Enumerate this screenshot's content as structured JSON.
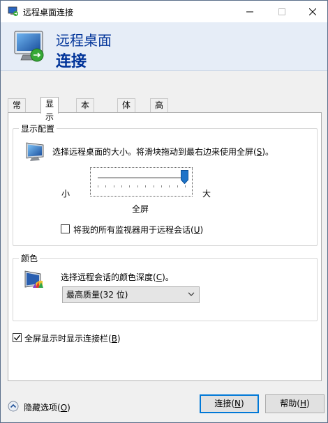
{
  "window": {
    "title": "远程桌面连接",
    "controls": {
      "minimize": "—",
      "maximize": "☐",
      "close": "✕"
    }
  },
  "banner": {
    "line1": "远程桌面",
    "line2": "连接"
  },
  "tabs": [
    {
      "label": "常规",
      "active": false
    },
    {
      "label": "显示",
      "active": true
    },
    {
      "label": "本地资源",
      "active": false
    },
    {
      "label": "体验",
      "active": false
    },
    {
      "label": "高级",
      "active": false
    }
  ],
  "display_config": {
    "group_title": "显示配置",
    "description": "选择远程桌面的大小。将滑块拖动到最右边来使用全屏(",
    "description_key": "S",
    "description_end": ")。",
    "slider_min_label": "小",
    "slider_max_label": "大",
    "slider_value_label": "全屏",
    "slider_position": 1.0,
    "use_all_monitors_label": "将我的所有监视器用于远程会话(",
    "use_all_monitors_key": "U",
    "use_all_monitors_end": ")",
    "use_all_monitors_checked": false
  },
  "colors": {
    "group_title": "颜色",
    "description": "选择远程会话的颜色深度(",
    "description_key": "C",
    "description_end": ")。",
    "selected_depth": "最高质量(32 位)"
  },
  "connection_bar": {
    "label": "全屏显示时显示连接栏(",
    "label_key": "B",
    "label_end": ")",
    "checked": true
  },
  "footer": {
    "hide_options": "隐藏选项(",
    "hide_options_key": "O",
    "hide_options_end": ")",
    "connect": "连接(",
    "connect_key": "N",
    "connect_end": ")",
    "help": "帮助(",
    "help_key": "H",
    "help_end": ")"
  },
  "theme": {
    "banner_text": "#003399",
    "accent": "#0078d7",
    "slider_thumb": "#1e73c8"
  }
}
